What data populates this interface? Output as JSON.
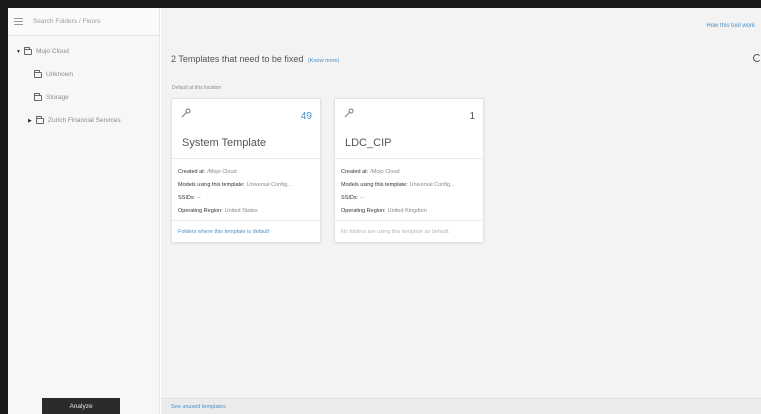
{
  "sidebar": {
    "search_placeholder": "Search Folders / Floors",
    "tree": [
      {
        "label": "Mojo Cloud",
        "expanded": true,
        "level": 0
      },
      {
        "label": "Unknown",
        "level": 1
      },
      {
        "label": "Storage",
        "level": 1
      },
      {
        "label": "Zurich Financial Services",
        "expanded": false,
        "level": 1
      }
    ],
    "analyze_label": "Analyze"
  },
  "main": {
    "help_link": "How this tool work",
    "heading": "2 Templates that need to be fixed",
    "know_more": "(Know more)",
    "default_label": "Default at this location",
    "footer_link": "See unused templates",
    "cards": [
      {
        "count": "49",
        "title": "System Template",
        "created_label": "Created at:",
        "created_value": "/Mojo Cloud",
        "models_label": "Models using this template:",
        "models_value": "Universal Config...",
        "ssids_label": "SSIDs:",
        "ssids_value": "--",
        "region_label": "Operating Region:",
        "region_value": "United States",
        "footer": "Folders where this template is default"
      },
      {
        "count": "1",
        "title": "LDC_CIP",
        "created_label": "Created at:",
        "created_value": "/Mojo Cloud",
        "models_label": "Models using this template:",
        "models_value": "Universal Config...",
        "ssids_label": "SSIDs:",
        "ssids_value": "--",
        "region_label": "Operating Region:",
        "region_value": "United Kingdom",
        "footer": "No folders are using this template as default."
      }
    ]
  },
  "colors": {
    "accent": "#4a90c8",
    "button": "#2b2b2b",
    "border": "#1a1a1a"
  },
  "icons": {
    "menu": "hamburger-icon",
    "folder": "folder-icon",
    "wrench": "wrench-icon",
    "refresh": "refresh-icon"
  }
}
